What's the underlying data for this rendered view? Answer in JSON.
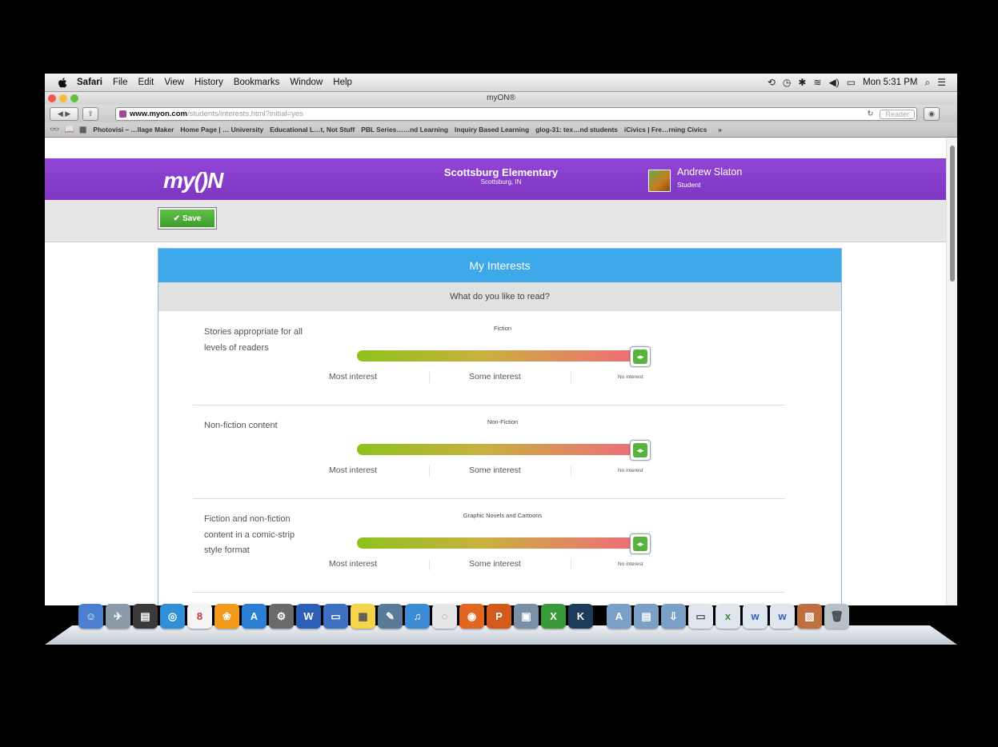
{
  "menubar": {
    "apple_icon": "apple-icon",
    "items": [
      "Safari",
      "File",
      "Edit",
      "View",
      "History",
      "Bookmarks",
      "Window",
      "Help"
    ],
    "clock": "Mon 5:31 PM"
  },
  "window": {
    "title": "myON®"
  },
  "toolbar": {
    "url_host": "www.myon.com",
    "url_path": "/students/interests.html?initial=yes",
    "reader_label": "Reader"
  },
  "bookmarks": [
    "Photovisi – …llage Maker",
    "Home Page | … University",
    "Educational L…t, Not Stuff",
    "PBL Series……nd Learning",
    "Inquiry Based Learning",
    "glog-31: tex…nd students",
    "iCivics | Fre…rning Civics"
  ],
  "header": {
    "logo": "my()N",
    "school_name": "Scottsburg Elementary",
    "school_location": "Scottsburg, IN",
    "user_name": "Andrew Slaton",
    "user_role": "Student"
  },
  "actions": {
    "save_label": "Save"
  },
  "panel": {
    "title": "My Interests",
    "subtitle": "What do you like to read?"
  },
  "scale": {
    "most": "Most interest",
    "some": "Some interest",
    "none": "No interest"
  },
  "interests": [
    {
      "category": "Fiction",
      "description": "Stories appropriate for all levels of readers",
      "level": 1.0
    },
    {
      "category": "Non-Fiction",
      "description": "Non-fiction content",
      "level": 1.0
    },
    {
      "category": "Graphic Novels and Cartoons",
      "description": "Fiction and non-fiction content in a comic-strip style format",
      "level": 1.0
    }
  ],
  "colors": {
    "header_purple": "#8b3fcf",
    "panel_blue": "#3da9ea",
    "save_green": "#4caf38"
  }
}
